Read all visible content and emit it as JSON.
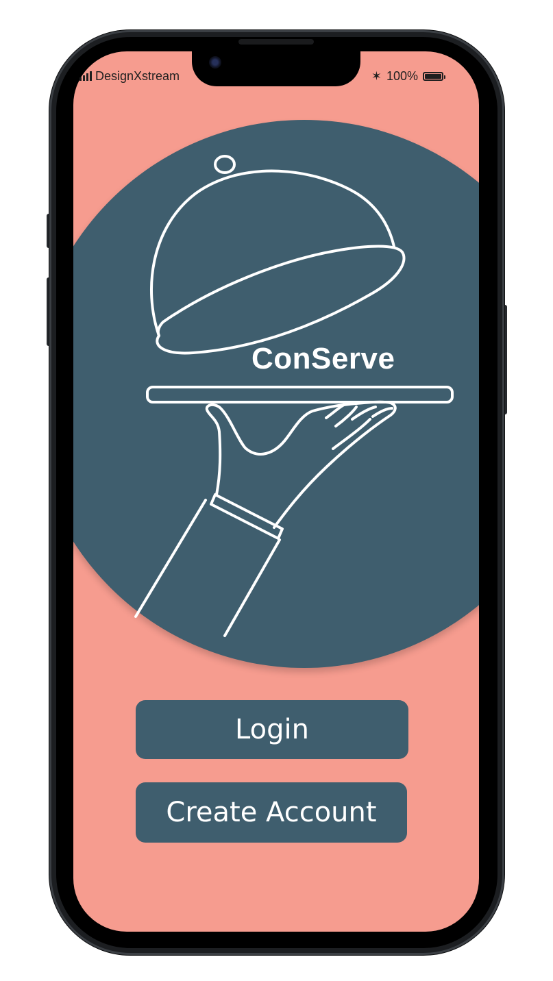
{
  "status_bar": {
    "carrier": "DesignXstream",
    "battery_percent": "100%",
    "signal_icon": "signal-bars-icon",
    "bluetooth_icon": "bluetooth-icon",
    "battery_icon": "battery-icon"
  },
  "hero": {
    "brand_name": "ConServe",
    "illustration": "waiter-hand-serving-cloche-tray"
  },
  "actions": {
    "login_label": "Login",
    "create_account_label": "Create Account"
  },
  "colors": {
    "background": "#f69c8f",
    "accent": "#3f5e6e",
    "text_on_accent": "#ffffff"
  }
}
